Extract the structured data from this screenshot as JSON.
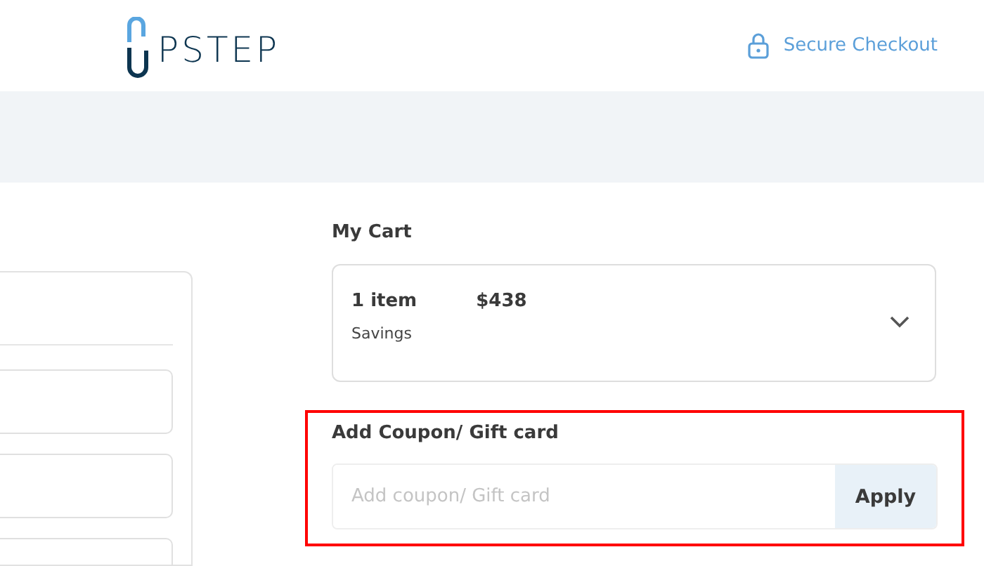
{
  "header": {
    "logo": "PSTEP",
    "secure": "Secure Checkout"
  },
  "left_panel": {
    "fields": [
      {
        "kind": "input"
      },
      {
        "kind": "input"
      },
      {
        "kind": "input"
      }
    ]
  },
  "cart": {
    "title": "My Cart",
    "count": "1 item",
    "price": "$438",
    "savings": "Savings",
    "expanded": false
  },
  "coupon": {
    "title": "Add Coupon/ Gift card",
    "placeholder": "Add coupon/ Gift card",
    "button": "Apply",
    "highlighted": true
  }
}
